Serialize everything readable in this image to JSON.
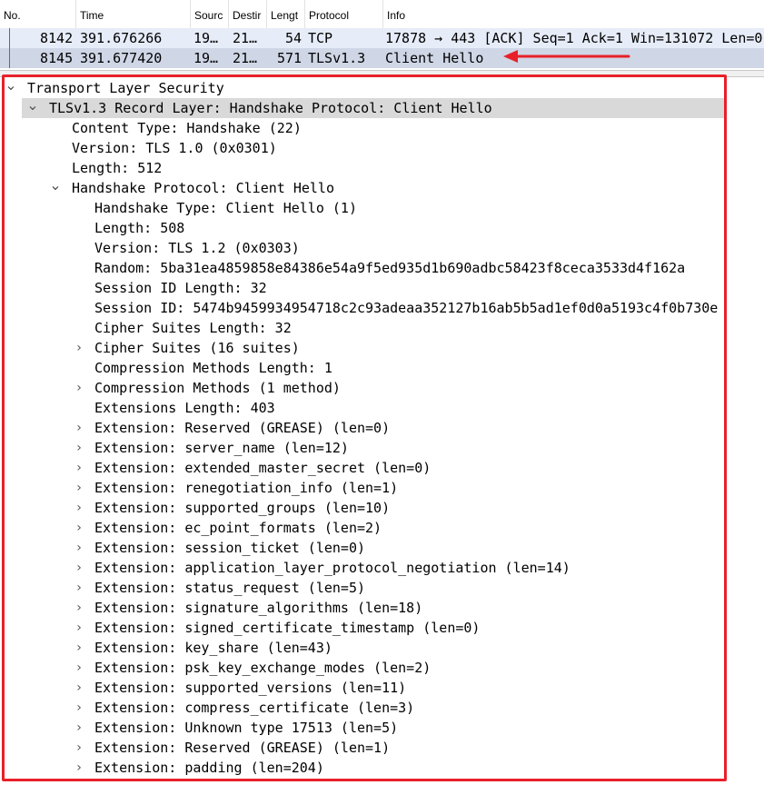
{
  "packet_list": {
    "columns": [
      "No.",
      "Time",
      "Sourc",
      "Destir",
      "Lengt",
      "Protocol",
      "Info"
    ],
    "rows": [
      {
        "no": "8142",
        "time": "391.676266",
        "source": "19…",
        "destination": "21…",
        "length": "54",
        "protocol": "TCP",
        "info": "17878 → 443 [ACK] Seq=1 Ack=1 Win=131072 Len=0"
      },
      {
        "no": "8145",
        "time": "391.677420",
        "source": "19…",
        "destination": "21…",
        "length": "571",
        "protocol": "TLSv1.3",
        "info": "Client Hello"
      }
    ]
  },
  "details": {
    "lines": [
      {
        "text": "Transport Layer Security",
        "expander": "expanded"
      },
      {
        "text": "TLSv1.3 Record Layer: Handshake Protocol: Client Hello",
        "expander": "expanded"
      },
      {
        "text": "Content Type: Handshake (22)",
        "expander": "none"
      },
      {
        "text": "Version: TLS 1.0 (0x0301)",
        "expander": "none"
      },
      {
        "text": "Length: 512",
        "expander": "none"
      },
      {
        "text": "Handshake Protocol: Client Hello",
        "expander": "expanded"
      },
      {
        "text": "Handshake Type: Client Hello (1)",
        "expander": "none"
      },
      {
        "text": "Length: 508",
        "expander": "none"
      },
      {
        "text": "Version: TLS 1.2 (0x0303)",
        "expander": "none"
      },
      {
        "text": "Random: 5ba31ea4859858e84386e54a9f5ed935d1b690adbc58423f8ceca3533d4f162a",
        "expander": "none"
      },
      {
        "text": "Session ID Length: 32",
        "expander": "none"
      },
      {
        "text": "Session ID: 5474b9459934954718c2c93adeaa352127b16ab5b5ad1ef0d0a5193c4f0b730e",
        "expander": "none"
      },
      {
        "text": "Cipher Suites Length: 32",
        "expander": "none"
      },
      {
        "text": "Cipher Suites (16 suites)",
        "expander": "collapsed"
      },
      {
        "text": "Compression Methods Length: 1",
        "expander": "none"
      },
      {
        "text": "Compression Methods (1 method)",
        "expander": "collapsed"
      },
      {
        "text": "Extensions Length: 403",
        "expander": "none"
      },
      {
        "text": "Extension: Reserved (GREASE) (len=0)",
        "expander": "collapsed"
      },
      {
        "text": "Extension: server_name (len=12)",
        "expander": "collapsed"
      },
      {
        "text": "Extension: extended_master_secret (len=0)",
        "expander": "collapsed"
      },
      {
        "text": "Extension: renegotiation_info (len=1)",
        "expander": "collapsed"
      },
      {
        "text": "Extension: supported_groups (len=10)",
        "expander": "collapsed"
      },
      {
        "text": "Extension: ec_point_formats (len=2)",
        "expander": "collapsed"
      },
      {
        "text": "Extension: session_ticket (len=0)",
        "expander": "collapsed"
      },
      {
        "text": "Extension: application_layer_protocol_negotiation (len=14)",
        "expander": "collapsed"
      },
      {
        "text": "Extension: status_request (len=5)",
        "expander": "collapsed"
      },
      {
        "text": "Extension: signature_algorithms (len=18)",
        "expander": "collapsed"
      },
      {
        "text": "Extension: signed_certificate_timestamp (len=0)",
        "expander": "collapsed"
      },
      {
        "text": "Extension: key_share (len=43)",
        "expander": "collapsed"
      },
      {
        "text": "Extension: psk_key_exchange_modes (len=2)",
        "expander": "collapsed"
      },
      {
        "text": "Extension: supported_versions (len=11)",
        "expander": "collapsed"
      },
      {
        "text": "Extension: compress_certificate (len=3)",
        "expander": "collapsed"
      },
      {
        "text": "Extension: Unknown type 17513 (len=5)",
        "expander": "collapsed"
      },
      {
        "text": "Extension: Reserved (GREASE) (len=1)",
        "expander": "collapsed"
      },
      {
        "text": "Extension: padding (len=204)",
        "expander": "collapsed"
      }
    ]
  },
  "colors": {
    "annotation_red": "#e8202a",
    "row_selected_bg": "#cfd6e6",
    "row_bg": "#e6ecf8"
  }
}
